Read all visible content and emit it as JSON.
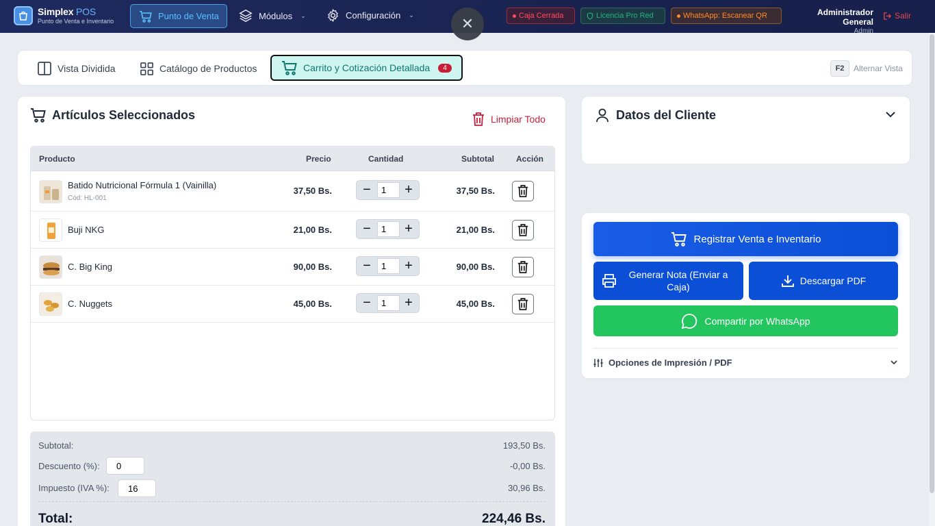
{
  "app": {
    "name": "Simplex",
    "name_accent": "POS",
    "subtitle": "Punto de Venta e Inventario"
  },
  "nav": {
    "pos": "Punto de Venta",
    "modules": "Módulos",
    "config": "Configuración"
  },
  "status": {
    "cash": "Caja Cerrada",
    "license": "Licencia Pro Red",
    "whatsapp": "WhatsApp: Escanear QR"
  },
  "user": {
    "name": "Administrador General",
    "role": "Admin",
    "logout": "Salir"
  },
  "close_symbol": "✕",
  "tabs": {
    "split": "Vista Dividida",
    "catalog": "Catálogo de Productos",
    "cart": "Carrito y Cotización Detallada",
    "cart_count": "4",
    "shortcut_key": "F2",
    "shortcut_label": "Alternar Vista"
  },
  "cart": {
    "title": "Artículos Seleccionados",
    "clear": "Limpiar Todo",
    "columns": {
      "product": "Producto",
      "price": "Precio",
      "qty": "Cantidad",
      "subtotal": "Subtotal",
      "action": "Acción"
    },
    "items": [
      {
        "name": "Batido Nutricional Fórmula 1 (Vainilla)",
        "code": "Cód: HL-001",
        "price": "37,50 Bs.",
        "qty": "1",
        "subtotal": "37,50 Bs."
      },
      {
        "name": "Buji NKG",
        "code": "",
        "price": "21,00 Bs.",
        "qty": "1",
        "subtotal": "21,00 Bs."
      },
      {
        "name": "C. Big King",
        "code": "",
        "price": "90,00 Bs.",
        "qty": "1",
        "subtotal": "90,00 Bs."
      },
      {
        "name": "C. Nuggets",
        "code": "",
        "price": "45,00 Bs.",
        "qty": "1",
        "subtotal": "45,00 Bs."
      }
    ]
  },
  "totals": {
    "subtotal_label": "Subtotal:",
    "subtotal": "193,50 Bs.",
    "discount_label": "Descuento (%):",
    "discount_input": "0",
    "discount": "-0,00 Bs.",
    "tax_label": "Impuesto (IVA %):",
    "tax_input": "16",
    "tax": "30,96 Bs.",
    "total_label": "Total:",
    "total": "224,46 Bs."
  },
  "client": {
    "title": "Datos del Cliente"
  },
  "actions": {
    "register": "Registrar Venta e Inventario",
    "note": "Generar Nota (Enviar a Caja)",
    "pdf": "Descargar PDF",
    "whatsapp": "Compartir por WhatsApp",
    "print_options": "Opciones de Impresión / PDF"
  },
  "colors": {
    "primary": "#0b4fd6",
    "whatsapp": "#22c55e",
    "danger": "#c81e3a",
    "topbar": "#1e2a5e"
  }
}
